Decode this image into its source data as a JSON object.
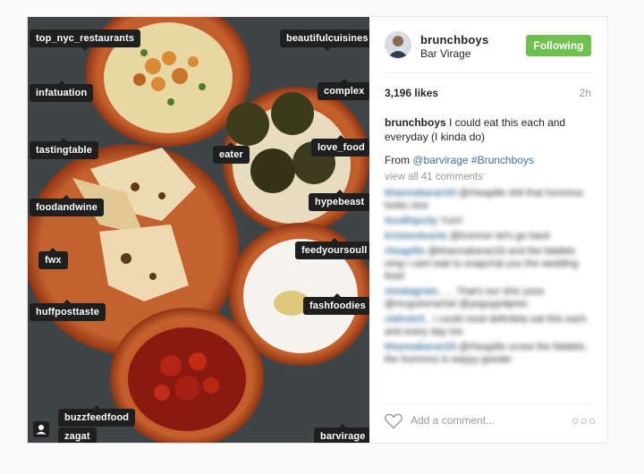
{
  "post": {
    "username": "brunchboys",
    "location": "Bar Virage",
    "follow_label": "Following",
    "likes": "3,196 likes",
    "time": "2h",
    "caption_user": "brunchboys",
    "caption_text": "I could eat this each and everyday (I kinda do)",
    "from_prefix": "From",
    "from_mention": "@barvirage",
    "from_hashtag": "#Brunchboys",
    "view_all": "view all 41 comments",
    "add_comment_placeholder": "Add a comment...",
    "more_label": "○○○"
  },
  "photo_tags": [
    {
      "label": "top_nyc_restaurants"
    },
    {
      "label": "beautifulcuisines"
    },
    {
      "label": "infatuation"
    },
    {
      "label": "complex"
    },
    {
      "label": "tastingtable"
    },
    {
      "label": "love_food"
    },
    {
      "label": "eater"
    },
    {
      "label": "foodandwine"
    },
    {
      "label": "hypebeast"
    },
    {
      "label": "fwx"
    },
    {
      "label": "feedyoursoull"
    },
    {
      "label": "huffposttaste"
    },
    {
      "label": "fashfoodies"
    },
    {
      "label": "buzzfeedfood"
    },
    {
      "label": "zagat"
    },
    {
      "label": "barvirage"
    }
  ],
  "comments": [
    {
      "user": "khannakaran33",
      "text": "@rheapills shit that hummus looks nice"
    },
    {
      "user": "foodhipcity",
      "text": "Yum!"
    },
    {
      "user": "kristenduarte",
      "text": "@tcormor let's go back"
    },
    {
      "user": "rheapills",
      "text": "@khannakaran33 and the falafels omg i cant wait to snapchat you the wedding food"
    },
    {
      "user": "ninatagram___",
      "text": "That's our shiz yooo @mcguirerachel @yeguypolpres"
    },
    {
      "user": "clahutch_",
      "text": "I could most definitely eat this each and every day too"
    },
    {
      "user": "khannakaran33",
      "text": "@rheapills screw the falafels, the hummus is wayyy gooder"
    }
  ],
  "colors": {
    "follow_button": "#70c050",
    "link": "#3f729b",
    "tag_bg": "#1f1f1f"
  },
  "icons": [
    "avatar",
    "heart-icon",
    "user-tag-icon",
    "more-icon"
  ]
}
